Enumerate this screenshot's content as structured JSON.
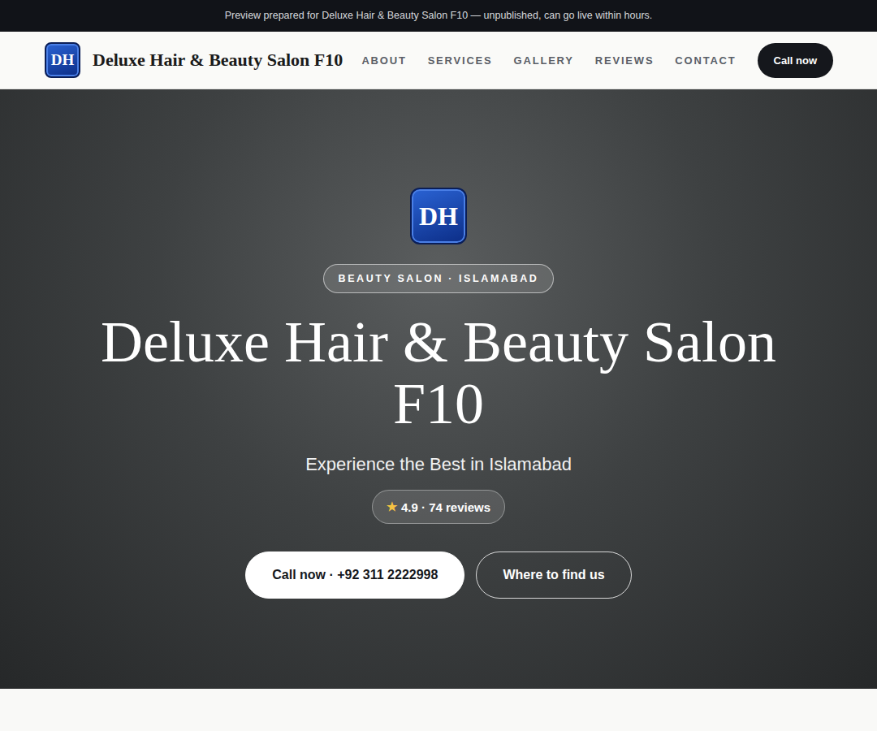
{
  "banner": {
    "text": "Preview prepared for Deluxe Hair & Beauty Salon F10 — unpublished, can go live within hours."
  },
  "header": {
    "logo": "DH",
    "name": "Deluxe Hair & Beauty Salon F10",
    "nav": [
      "ABOUT",
      "SERVICES",
      "GALLERY",
      "REVIEWS",
      "CONTACT"
    ],
    "cta": "Call now"
  },
  "hero": {
    "logo": "DH",
    "eyebrow": "BEAUTY SALON · ISLAMABAD",
    "title": "Deluxe Hair & Beauty Salon F10",
    "subtitle": "Experience the Best in Islamabad",
    "rating": {
      "star": "★",
      "text": "4.9 · 74 reviews"
    },
    "buttons": [
      {
        "label": "Call now · +92 311 2222998",
        "kind": "primary"
      },
      {
        "label": "Where to find us",
        "kind": "outline"
      }
    ]
  }
}
